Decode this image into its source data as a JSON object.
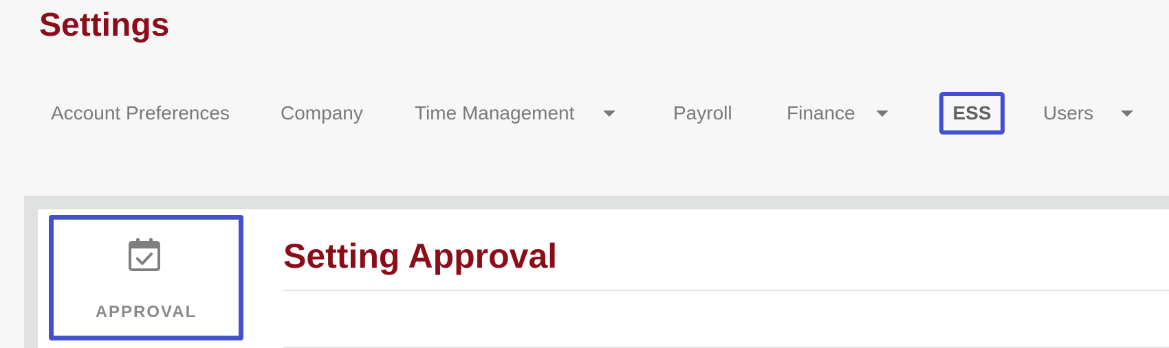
{
  "page": {
    "title": "Settings"
  },
  "nav": {
    "items": [
      {
        "label": "Account Preferences",
        "has_dropdown": false,
        "active": false
      },
      {
        "label": "Company",
        "has_dropdown": false,
        "active": false
      },
      {
        "label": "Time Management",
        "has_dropdown": true,
        "active": false
      },
      {
        "label": "Payroll",
        "has_dropdown": false,
        "active": false
      },
      {
        "label": "Finance",
        "has_dropdown": true,
        "active": false
      },
      {
        "label": "ESS",
        "has_dropdown": false,
        "active": true
      },
      {
        "label": "Users",
        "has_dropdown": true,
        "active": false
      }
    ]
  },
  "sidebar": {
    "card": {
      "label": "APPROVAL",
      "icon": "calendar-check-icon"
    }
  },
  "main": {
    "section_title": "Setting Approval"
  },
  "colors": {
    "brand": "#8b0d19",
    "highlight": "#4450d0",
    "muted_text": "#7a7a7a",
    "band": "#dfe2e1"
  }
}
